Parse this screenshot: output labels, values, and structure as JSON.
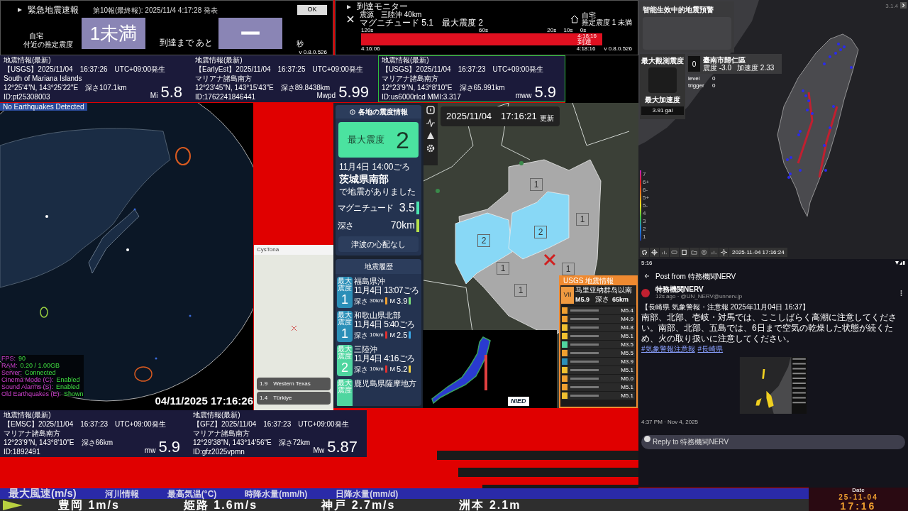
{
  "eew": {
    "title": "緊急地震速報",
    "report": "第10報(最終報): 2025/11/4 4:17:28 発表",
    "ok_button": "OK",
    "location_label": "自宅",
    "intensity_label": "付近の推定震度",
    "intensity": "1未満",
    "countdown_label": "到達まで あと",
    "countdown": "ー",
    "unit": "秒",
    "version": "v 0.8.0.526"
  },
  "arrival_monitor": {
    "title": "到達モニター",
    "epicenter": "震源　三陸沖 40km",
    "summary": "マグニチュード 5.1　最大震度 2",
    "home_label": "自宅",
    "home_intensity": "推定震度 1 未満",
    "ticks": [
      "120s",
      "60s",
      "20s",
      "10s",
      "0s"
    ],
    "arrival_time": "4:18:16",
    "arrival_label": "到達",
    "start_time": "4:16:06",
    "end_time": "4:18:16",
    "version": "v 0.8.0.526"
  },
  "top_cards": [
    {
      "title": "地震情報(最新)",
      "source": "【USGS】2025/11/04　16:37:26　UTC+09:00発生",
      "place": "South of Mariana Islands",
      "coords": "12°25'4\"N,  143°25'22\"E　深さ107.1km",
      "id": "ID:pt25308003",
      "mag_type": "Mi",
      "magnitude": "5.8",
      "highlighted": false
    },
    {
      "title": "地震情報(最新)",
      "source": "【EarlyEst】2025/11/04　16:37:25　UTC+09:00発生",
      "place": "マリアナ諸島南方",
      "coords": "12°23'45\"N,  143°15'43\"E　深さ89.8438km",
      "id": "ID:1762241846441",
      "mag_type": "Mwpd",
      "magnitude": "5.99",
      "highlighted": false
    },
    {
      "title": "地震情報(最新)",
      "source": "【USGS】2025/11/04　16:37:23　UTC+09:00発生",
      "place": "マリアナ諸島南方",
      "coords": "12°23'9\"N,  143°8'10\"E　深さ65.991km",
      "id": "ID:us6000rlcd MMI:3.317",
      "mag_type": "mww",
      "magnitude": "5.9",
      "highlighted": true
    }
  ],
  "globe": {
    "status": "No Earthquakes Detected",
    "stats": [
      {
        "label": "FPS:",
        "value": "90"
      },
      {
        "label": "RAM:",
        "value": "0.20 / 1.00GB"
      },
      {
        "label": "Server:",
        "value": "Connected"
      },
      {
        "label": "Cinema Mode (C):",
        "value": "Enabled"
      },
      {
        "label": "Sound Alarms (S):",
        "value": "Enabled"
      },
      {
        "label": "Old Earthquakes (E):",
        "value": "Shown"
      }
    ],
    "timestamp": "04/11/2025 17:16:26"
  },
  "mini_map_window": {
    "title": "CysTona",
    "events": [
      {
        "magnitude": "1.9",
        "place": "Western Texas"
      },
      {
        "magnitude": "1.4",
        "place": "Türkiye"
      }
    ]
  },
  "intensity_app": {
    "panel_title": "各地の震度情報",
    "max_label": "最大震度",
    "max_intensity": "2",
    "time": "11月4日 14:00ごろ",
    "region": "茨城県南部",
    "note": "で地震がありました",
    "magnitude_label": "マグニチュード",
    "magnitude": "3.5",
    "magnitude_bar": {
      "color": "#4be3b0"
    },
    "depth_label": "深さ",
    "depth": "70km",
    "depth_bar": {
      "color": "#b5e04a"
    },
    "tsunami": "津波の心配なし",
    "history_title": "地震履歴",
    "history": [
      {
        "badge_label": "最大震度",
        "intensity": "1",
        "color": "#2b8fb8",
        "place": "福島県沖",
        "time": "11月4日 13:07ごろ",
        "depth_label": "深さ",
        "depth": "30km",
        "depth_bar": {
          "color": "#f0a030"
        },
        "mag_label": "M",
        "magnitude": "3.9",
        "mag_bar": {
          "color": "#7be07b"
        }
      },
      {
        "badge_label": "最大震度",
        "intensity": "1",
        "color": "#2b8fb8",
        "place": "和歌山県北部",
        "time": "11月4日 5:40ごろ",
        "depth_label": "深さ",
        "depth": "10km",
        "depth_bar": {
          "color": "#e03030"
        },
        "mag_label": "M",
        "magnitude": "2.5",
        "mag_bar": {
          "color": "#3aa8e8"
        }
      },
      {
        "badge_label": "最大震度",
        "intensity": "2",
        "color": "#4fd6a0",
        "place": "三陸沖",
        "time": "11月4日 4:16ごろ",
        "depth_label": "深さ",
        "depth": "10km",
        "depth_bar": {
          "color": "#e03030"
        },
        "mag_label": "M",
        "magnitude": "5.2",
        "mag_bar": {
          "color": "#f0d040"
        }
      },
      {
        "badge_label": "最大震度",
        "color": "#4fd6a0",
        "place": "鹿児島県薩摩地方"
      }
    ],
    "map_timestamp": "2025/11/04　17:16:21",
    "map_updated": "更新",
    "map_labels": [
      {
        "text": "1",
        "color": "#a8a8a8"
      },
      {
        "text": "1",
        "color": "#a8a8a8"
      },
      {
        "text": "2",
        "color": "#7fd8f8"
      },
      {
        "text": "2",
        "color": "#7fd8f8"
      },
      {
        "text": "1",
        "color": "#a8a8a8"
      },
      {
        "text": "1",
        "color": "#a8a8a8"
      },
      {
        "text": "1",
        "color": "#a8a8a8"
      }
    ],
    "nied_logo": "NIED",
    "usgs": {
      "title": "USGS 地震情報",
      "intensity": "VII",
      "place": "马里亚纳群岛以南",
      "magnitude": "M5.9",
      "depth_label": "深さ",
      "depth": "65km",
      "list": [
        {
          "color": "#f0a030",
          "magnitude": "M5.4"
        },
        {
          "color": "#f0a030",
          "magnitude": "M4.9"
        },
        {
          "color": "#f0c030",
          "magnitude": "M4.8"
        },
        {
          "color": "#f0c030",
          "magnitude": "M5.1"
        },
        {
          "color": "#4fd6a0",
          "magnitude": "M3.5"
        },
        {
          "color": "#f0a030",
          "magnitude": "M5.5"
        },
        {
          "color": "#2b8fb8",
          "magnitude": "M3.9"
        },
        {
          "color": "#f0c030",
          "magnitude": "M5.1"
        },
        {
          "color": "#f0a030",
          "magnitude": "M6.0"
        },
        {
          "color": "#f0a030",
          "magnitude": "M5.1"
        },
        {
          "color": "#f0c030",
          "magnitude": "M5.1"
        }
      ]
    }
  },
  "taiwan": {
    "warning_title": "智能生效中的地震預警",
    "max_observed_label": "最大觀測震度",
    "station_intensity": "0",
    "station": "臺南市歸仁區",
    "station_intensity_reading": "震度 -3.0",
    "station_accel": "加速度 2.33",
    "level_label": "level",
    "level_value": "0",
    "trigger_label": "trigger",
    "trigger_value": "0",
    "max_accel_label": "最大加速度",
    "max_accel": "3.91 gal",
    "version": "3.1.4",
    "scale": [
      "7",
      "6+",
      "6-",
      "5+",
      "5-",
      "4",
      "3",
      "2",
      "1"
    ],
    "timestamp": "2025-11-04 17:16:24"
  },
  "nerv_post": {
    "status_time": "5:16",
    "header": "Post from 特務機関NERV",
    "author": "特務機関NERV",
    "meta": "12s ago · @UN_NERV@unnerv.jp",
    "heading": "【長崎県 気象警報・注意報 2025年11月04日 16:37】",
    "body": "南部、北部、壱岐・対馬では、ここしばらく高潮に注意してください。南部、北部、五島では、6日まで空気の乾燥した状態が続くため、火の取り扱いに注意してください。",
    "hashtags": [
      "#気象警報注意報",
      "#長崎県"
    ],
    "posted": "4:37 PM · Nov 4, 2025",
    "reply_placeholder": "Reply to 特務機関NERV"
  },
  "bottom_cards": [
    {
      "title": "地震情報(最新)",
      "source": "【EMSC】2025/11/04　16:37:23　UTC+09:00発生",
      "place": "マリアナ諸島南方",
      "coords": "12°23'9\"N,  143°8'10\"E　深さ66km",
      "id": "ID:1892491",
      "mag_type": "mw",
      "magnitude": "5.9",
      "highlighted": false
    },
    {
      "title": "地震情報(最新)",
      "source": "【GFZ】2025/11/04　16:37:23　UTC+09:00発生",
      "place": "マリアナ諸島南方",
      "coords": "12°29'38\"N,  143°14'56\"E　深さ72km",
      "id": "ID:gfz2025vpmn",
      "mag_type": "Mw",
      "magnitude": "5.87",
      "highlighted": false
    }
  ],
  "ticker": {
    "headings": [
      "最大風速(m/s)",
      "河川情報",
      "最高気温(°C)",
      "時降水量(mm/h)",
      "日降水量(mm/d)"
    ],
    "values": [
      "豊岡 1m/s",
      "姫路 1.6m/s",
      "神戸 2.7m/s",
      "洲本 2.1m"
    ],
    "date_label": "Date",
    "date": "25-11-04",
    "time": "17:16"
  }
}
